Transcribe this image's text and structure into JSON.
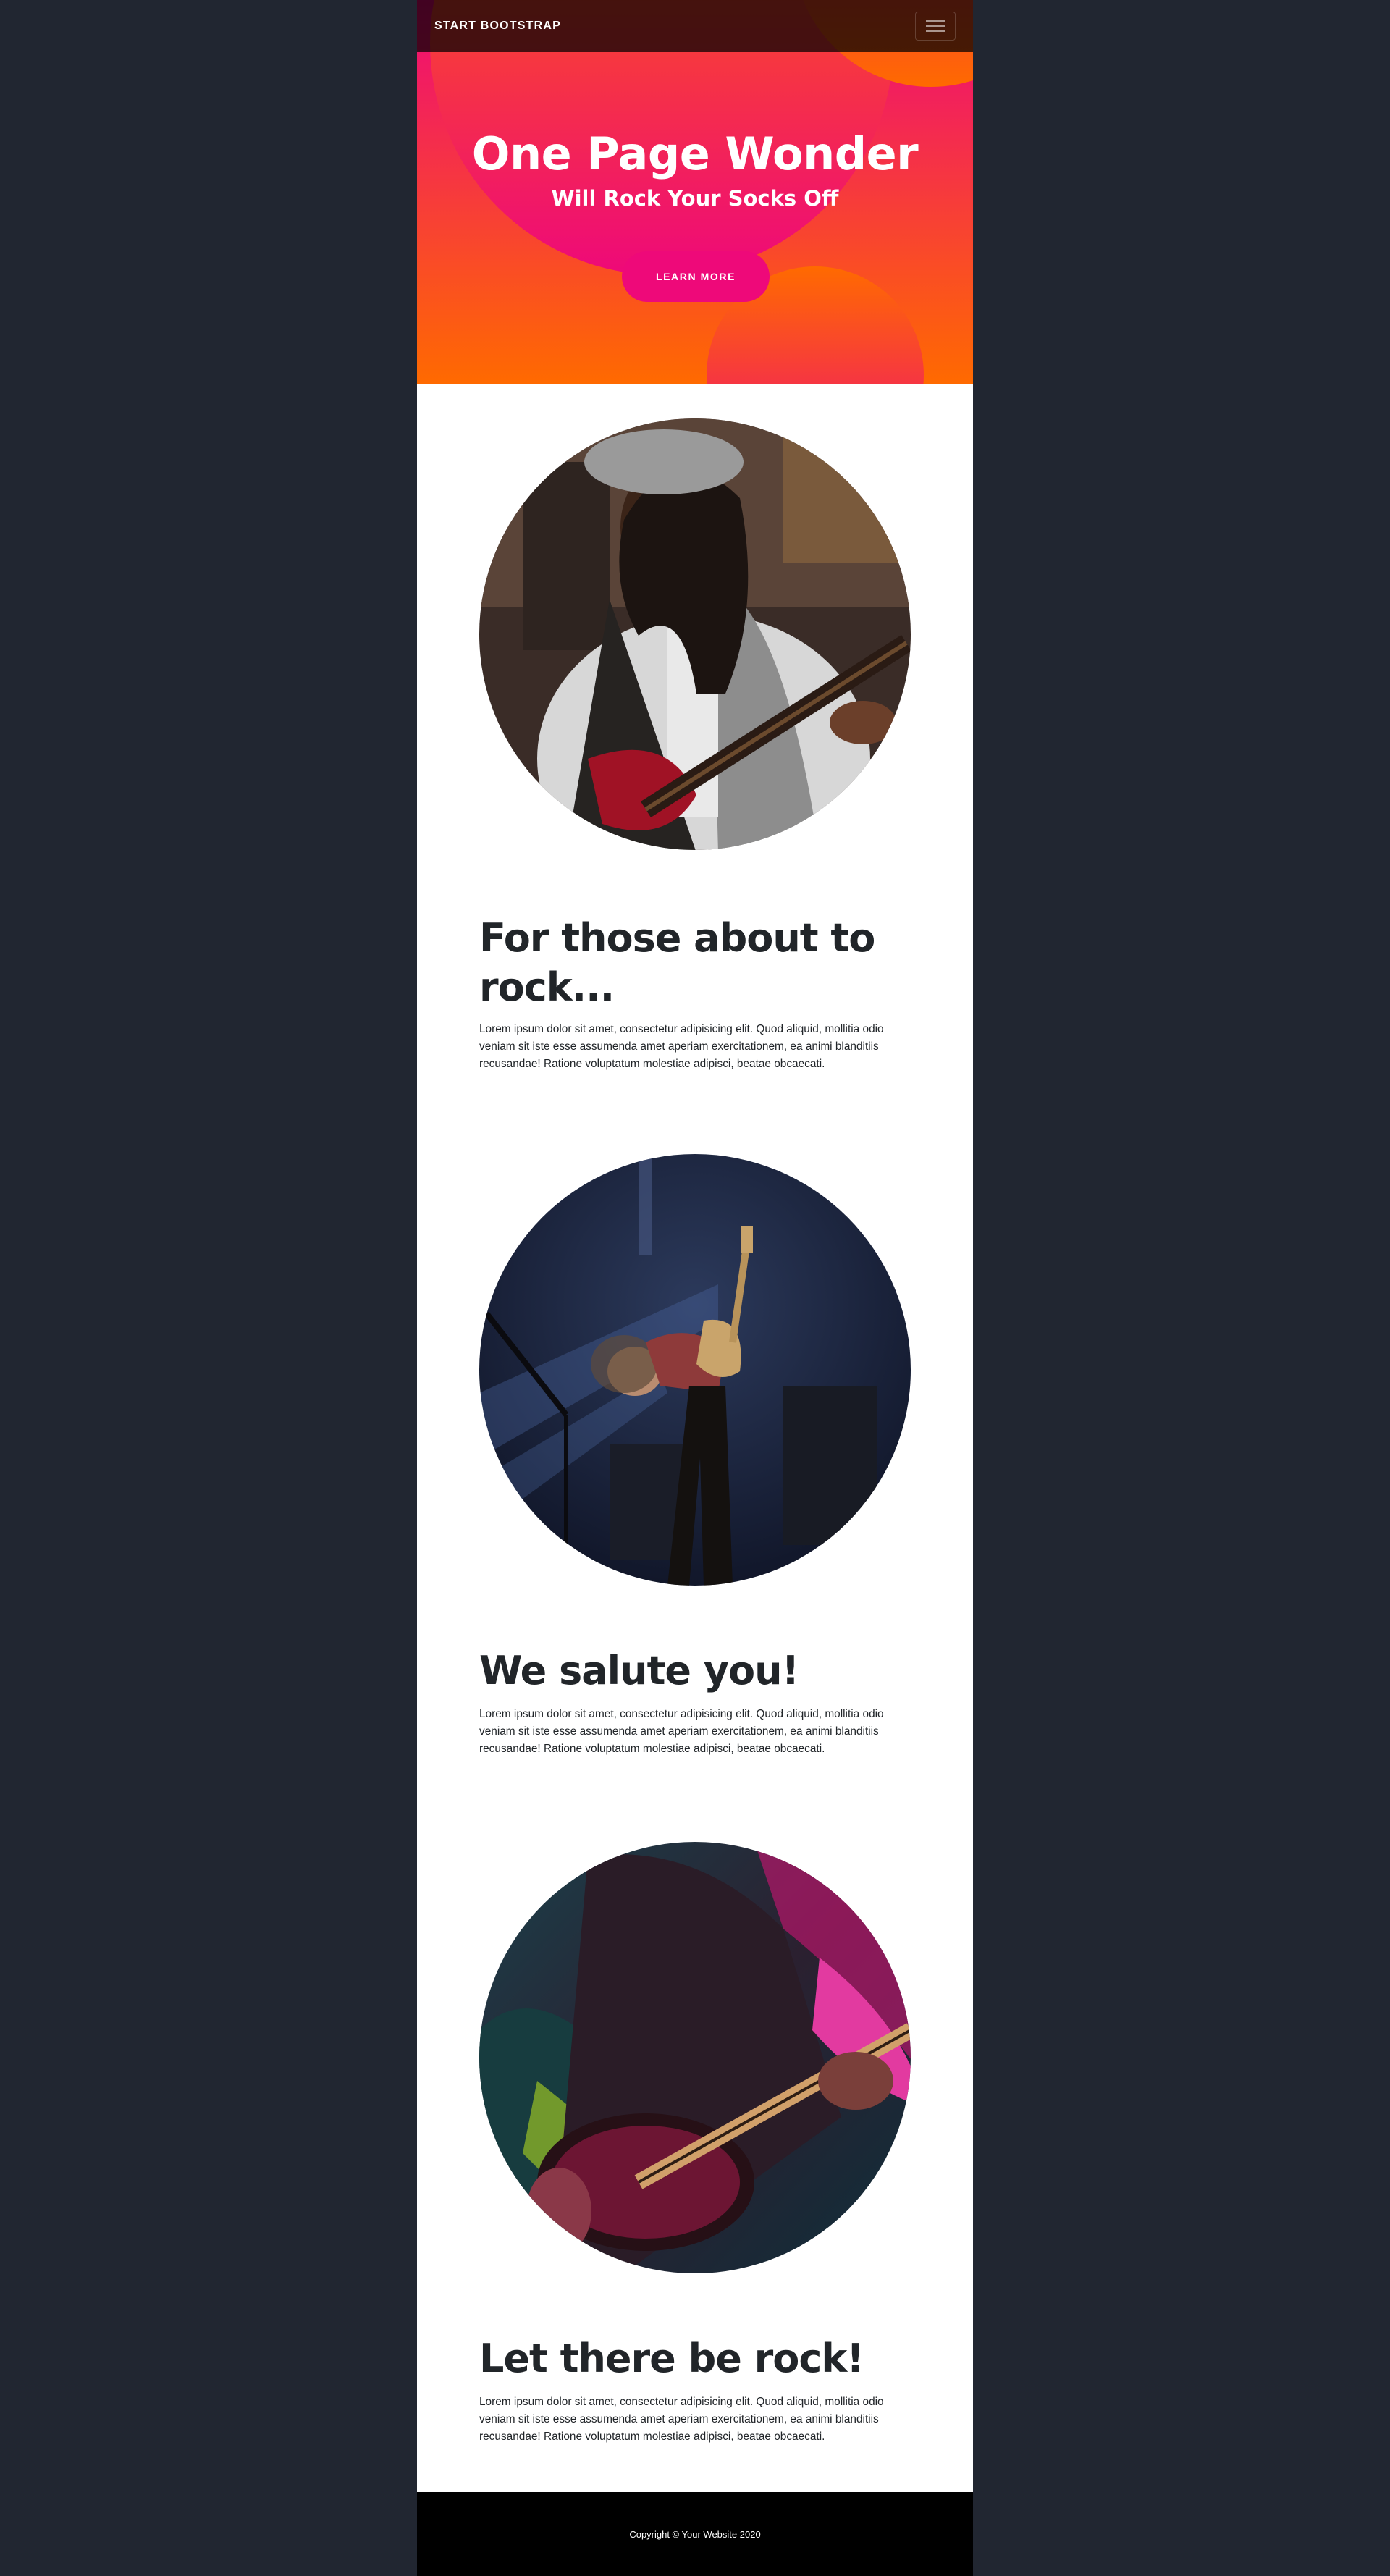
{
  "navbar": {
    "brand": "Start Bootstrap",
    "toggler_icon": "hamburger-menu-icon"
  },
  "hero": {
    "title": "One Page Wonder",
    "subtitle": "Will Rock Your Socks Off",
    "button_label": "Learn More",
    "colors": {
      "start": "#ff6a00",
      "end": "#ee0979"
    }
  },
  "sections": [
    {
      "title": "For those about to rock...",
      "text": "Lorem ipsum dolor sit amet, consectetur adipisicing elit. Quod aliquid, mollitia odio veniam sit iste esse assumenda amet aperiam exercitationem, ea animi blanditiis recusandae! Ratione voluptatum molestiae adipisci, beatae obcaecati.",
      "image": "guitarist-woman-photo"
    },
    {
      "title": "We salute you!",
      "text": "Lorem ipsum dolor sit amet, consectetur adipisicing elit. Quod aliquid, mollitia odio veniam sit iste esse assumenda amet aperiam exercitationem, ea animi blanditiis recusandae! Ratione voluptatum molestiae adipisci, beatae obcaecati.",
      "image": "guitarist-stage-photo"
    },
    {
      "title": "Let there be rock!",
      "text": "Lorem ipsum dolor sit amet, consectetur adipisicing elit. Quod aliquid, mollitia odio veniam sit iste esse assumenda amet aperiam exercitationem, ea animi blanditiis recusandae! Ratione voluptatum molestiae adipisci, beatae obcaecati.",
      "image": "guitar-closeup-photo"
    }
  ],
  "footer": {
    "copyright": "Copyright © Your Website 2020"
  }
}
